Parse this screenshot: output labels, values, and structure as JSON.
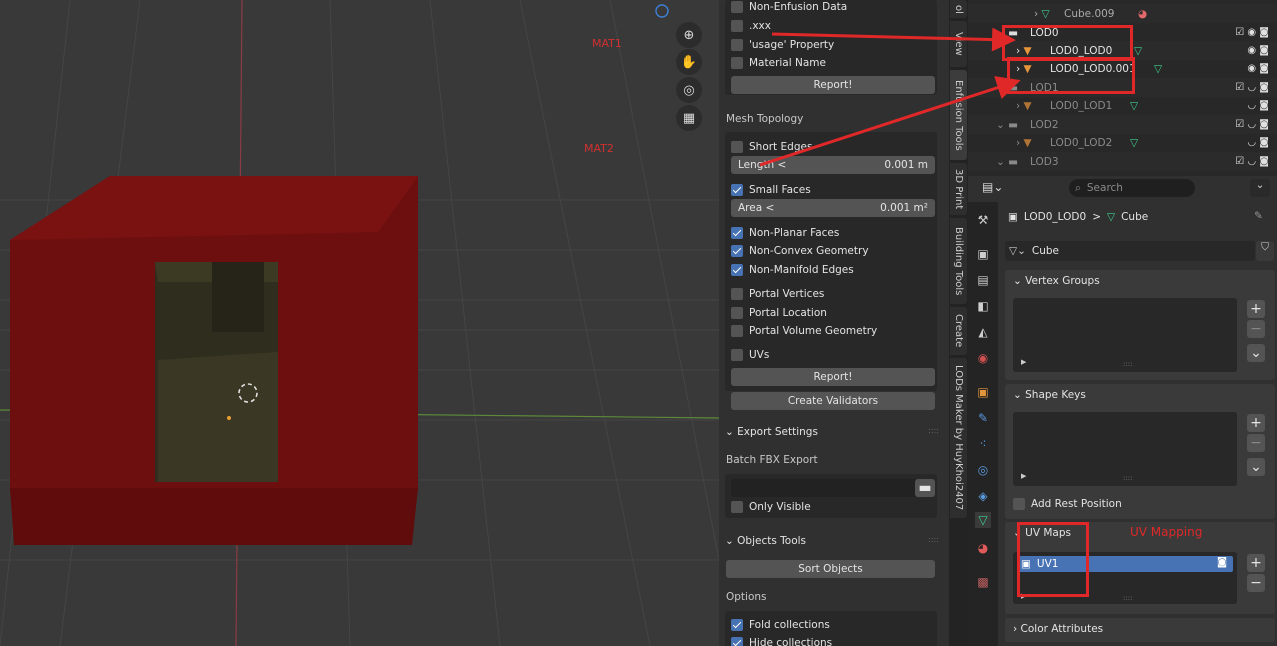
{
  "viewport": {
    "mat1_label": "MAT1",
    "mat2_label": "MAT2",
    "nav_icons": [
      "zoom-icon",
      "hand-pan-icon",
      "camera-icon",
      "grid-icon"
    ]
  },
  "validator": {
    "top_rows": [
      {
        "label": "Non-Enfusion Data",
        "checked": false
      },
      {
        "label": ".xxx",
        "checked": false
      },
      {
        "label": "'usage' Property",
        "checked": false
      },
      {
        "label": "Material Name",
        "checked": false
      }
    ],
    "report_label": "Report!",
    "mesh_topology_label": "Mesh Topology",
    "short_edges": "Short Edges",
    "length_label": "Length <",
    "length_value": "0.001 m",
    "small_faces": "Small Faces",
    "area_label": "Area <",
    "area_value": "0.001 m²",
    "checks": [
      {
        "label": "Non-Planar Faces",
        "checked": true
      },
      {
        "label": "Non-Convex Geometry",
        "checked": true
      },
      {
        "label": "Non-Manifold Edges",
        "checked": true
      }
    ],
    "portal_rows": [
      {
        "label": "Portal Vertices",
        "checked": false
      },
      {
        "label": "Portal Location",
        "checked": false
      },
      {
        "label": "Portal Volume Geometry",
        "checked": false
      }
    ],
    "uvs_label": "UVs",
    "report2_label": "Report!",
    "create_validators_label": "Create Validators"
  },
  "export": {
    "header": "Export Settings",
    "batch_label": "Batch FBX Export",
    "path_value": "",
    "only_visible": "Only Visible"
  },
  "objects_tools": {
    "header": "Objects Tools",
    "sort_label": "Sort Objects",
    "options_label": "Options",
    "fold_collections": "Fold collections",
    "hide_collections": "Hide collections"
  },
  "vtabs": [
    "ol",
    "View",
    "Enfusion Tools",
    "3D Print",
    "Building Tools",
    "Create",
    "LODs Maker by HuyKhoi2407"
  ],
  "outliner": {
    "rows": [
      {
        "name": "Cube.009",
        "kind": "mesh"
      },
      {
        "name": "LOD0",
        "kind": "collection"
      },
      {
        "name": "LOD0_LOD0",
        "kind": "object"
      },
      {
        "name": "LOD0_LOD0.001",
        "kind": "object"
      },
      {
        "name": "LOD1",
        "kind": "collection"
      },
      {
        "name": "LOD0_LOD1",
        "kind": "object"
      },
      {
        "name": "LOD2",
        "kind": "collection"
      },
      {
        "name": "LOD0_LOD2",
        "kind": "object"
      },
      {
        "name": "LOD3",
        "kind": "collection"
      }
    ]
  },
  "properties": {
    "search_placeholder": "Search",
    "breadcrumb_object": "LOD0_LOD0",
    "breadcrumb_sep": ">",
    "breadcrumb_mesh": "Cube",
    "mesh_name": "Cube",
    "vertex_groups": "Vertex Groups",
    "shape_keys": "Shape Keys",
    "add_rest_position": "Add Rest Position",
    "uv_maps": "UV Maps",
    "uv_item": "UV1",
    "color_attributes": "Color Attributes"
  },
  "annotations": {
    "uv_mapping": "UV Mapping"
  },
  "colors": {
    "accent": "#4772b3",
    "annotation_red": "#e02828",
    "cube_red": "#6e0f0f"
  }
}
